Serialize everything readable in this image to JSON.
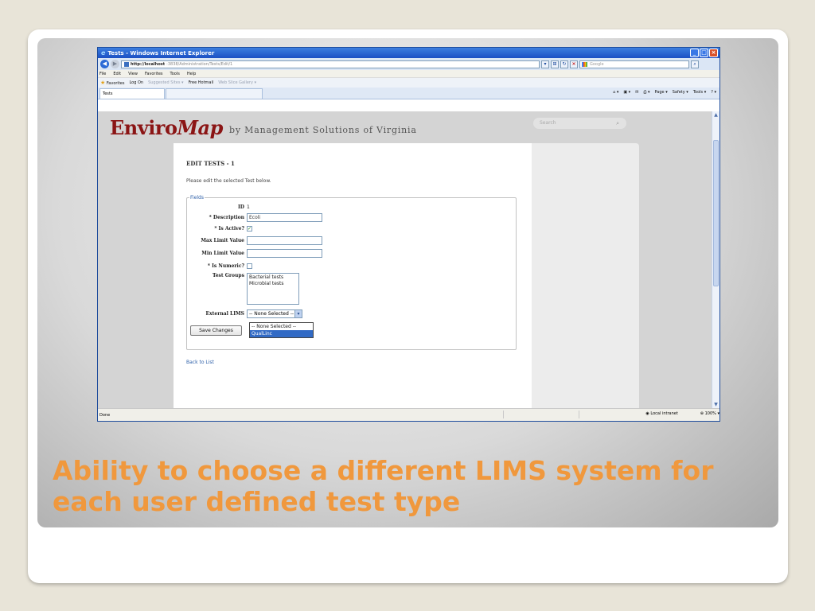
{
  "browser": {
    "title": "Tests - Windows Internet Explorer",
    "address_host": "http://localhost",
    "address_path": ":3838/Administration/Tests/Edit/1",
    "search_placeholder": "Google",
    "menu": [
      "File",
      "Edit",
      "View",
      "Favorites",
      "Tools",
      "Help"
    ],
    "favorites_label": "Favorites",
    "fav_links": [
      "Log On",
      "Suggested Sites ▾",
      "Free Hotmail",
      "Web Slice Gallery ▾"
    ],
    "tab_title": "Tests",
    "command_bar": [
      "Page ▾",
      "Safety ▾",
      "Tools ▾"
    ],
    "status": {
      "left": "Done",
      "zone": "Local intranet",
      "zoom": "100%"
    }
  },
  "site": {
    "brand_plain": "Enviro",
    "brand_italic": "Map",
    "tagline": "by Management Solutions of Virginia",
    "search_placeholder": "Search"
  },
  "form": {
    "title": "EDIT TESTS - 1",
    "intro": "Please edit the selected Test below.",
    "legend": "Fields",
    "id_label": "ID",
    "id_value": "1",
    "description_label": "* Description",
    "description_value": "Ecoli",
    "is_active_label": "* Is Active?",
    "is_active": true,
    "max_limit_label": "Max Limit Value",
    "max_limit_value": "",
    "min_limit_label": "Min Limit Value",
    "min_limit_value": "",
    "is_numeric_label": "* Is Numeric?",
    "is_numeric": false,
    "test_groups_label": "Test Groups",
    "test_groups": [
      "Bacterial tests",
      "Microbial tests"
    ],
    "external_lims_label": "External LIMS",
    "external_lims_selected": "-- None Selected --",
    "external_lims_options": [
      "-- None Selected --",
      "QualLinc"
    ],
    "external_lims_highlighted": "QualLinc",
    "save_button": "Save Changes",
    "back_link": "Back to List"
  },
  "slide": {
    "caption": "Ability to choose a different LIMS system for each user defined test type"
  },
  "colors": {
    "brand": "#8b1515",
    "caption": "#f0983d",
    "selection": "#316ac5",
    "link": "#2c5fa8"
  }
}
